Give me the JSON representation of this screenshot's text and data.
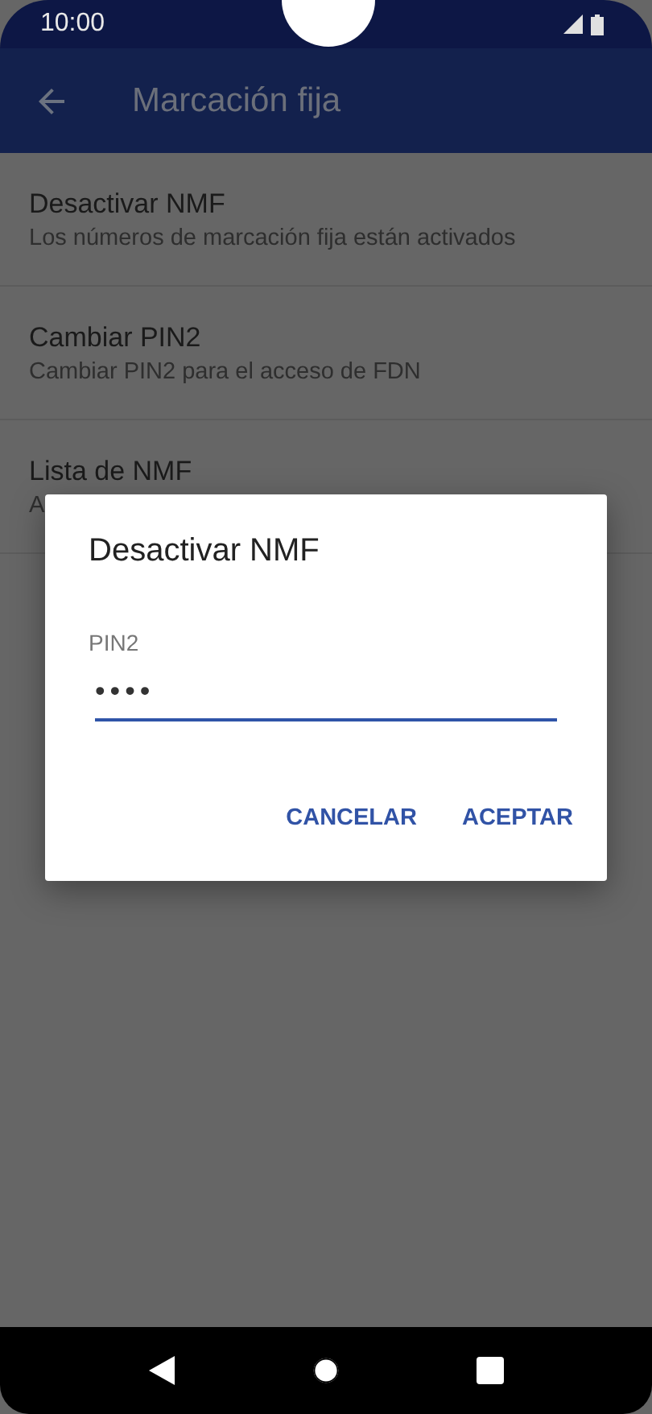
{
  "status_bar": {
    "time": "10:00"
  },
  "app_bar": {
    "title": "Marcación fija"
  },
  "items": [
    {
      "title": "Desactivar NMF",
      "subtitle": "Los números de marcación fija están activados"
    },
    {
      "title": "Cambiar PIN2",
      "subtitle": "Cambiar PIN2 para el acceso de FDN"
    },
    {
      "title": "Lista de NMF",
      "subtitle": "A"
    }
  ],
  "dialog": {
    "title": "Desactivar NMF",
    "field_label": "PIN2",
    "value": "••••",
    "buttons": [
      "CANCELAR",
      "ACEPTAR"
    ]
  }
}
